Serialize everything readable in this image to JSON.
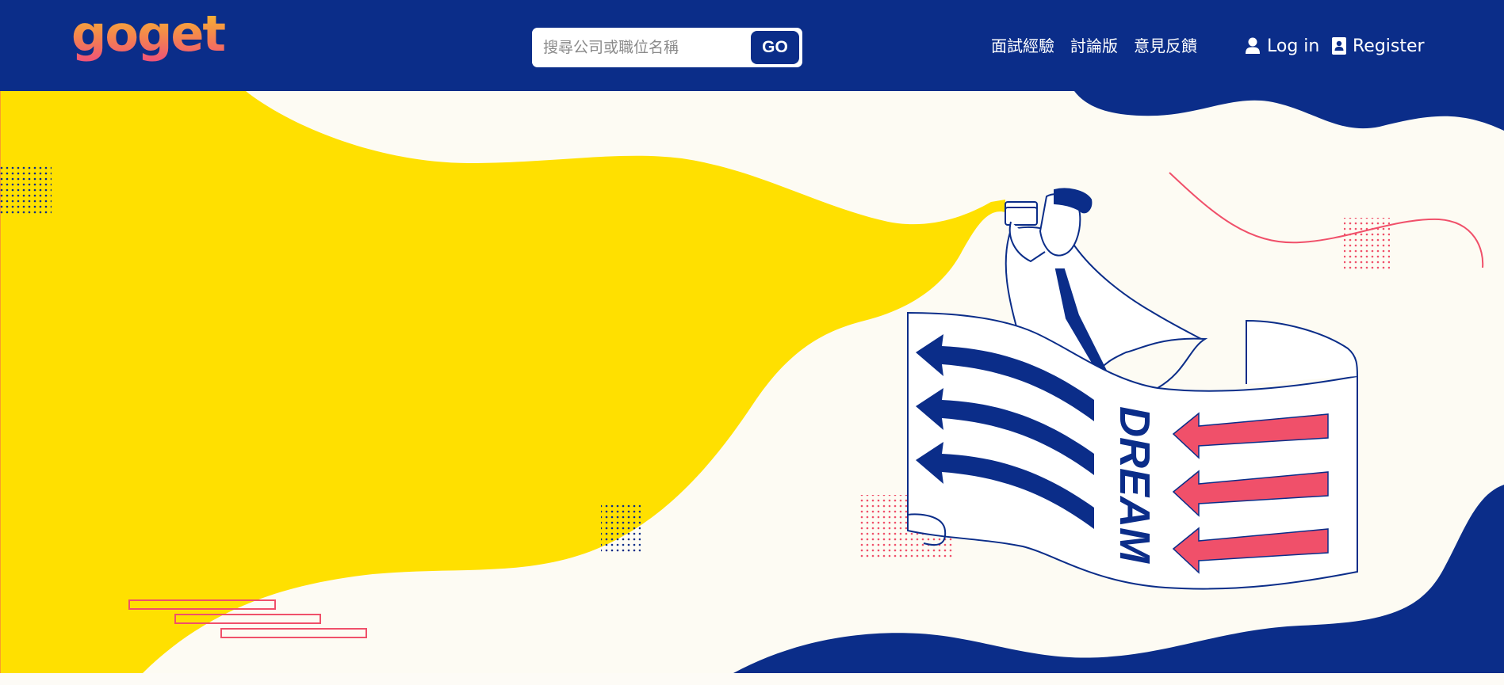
{
  "brand": {
    "logo_text": "goget",
    "logo_gradient": [
      "#f9c42a",
      "#f48a4a",
      "#f0507a"
    ]
  },
  "header": {
    "background": "#0b2d89",
    "search": {
      "placeholder": "搜尋公司或職位名稱",
      "value": "",
      "button_label": "GO"
    },
    "nav": [
      {
        "label": "面試經驗"
      },
      {
        "label": "討論版"
      },
      {
        "label": "意見反饋"
      }
    ],
    "auth": {
      "login_label": "Log in",
      "login_icon": "user-icon",
      "register_label": "Register",
      "register_icon": "contact-card-icon"
    }
  },
  "hero": {
    "banner_text": "DREAM",
    "colors": {
      "background": "#fdfbf3",
      "navy": "#0b2d89",
      "coral": "#f0506a",
      "yellow": "#ffde00"
    }
  }
}
